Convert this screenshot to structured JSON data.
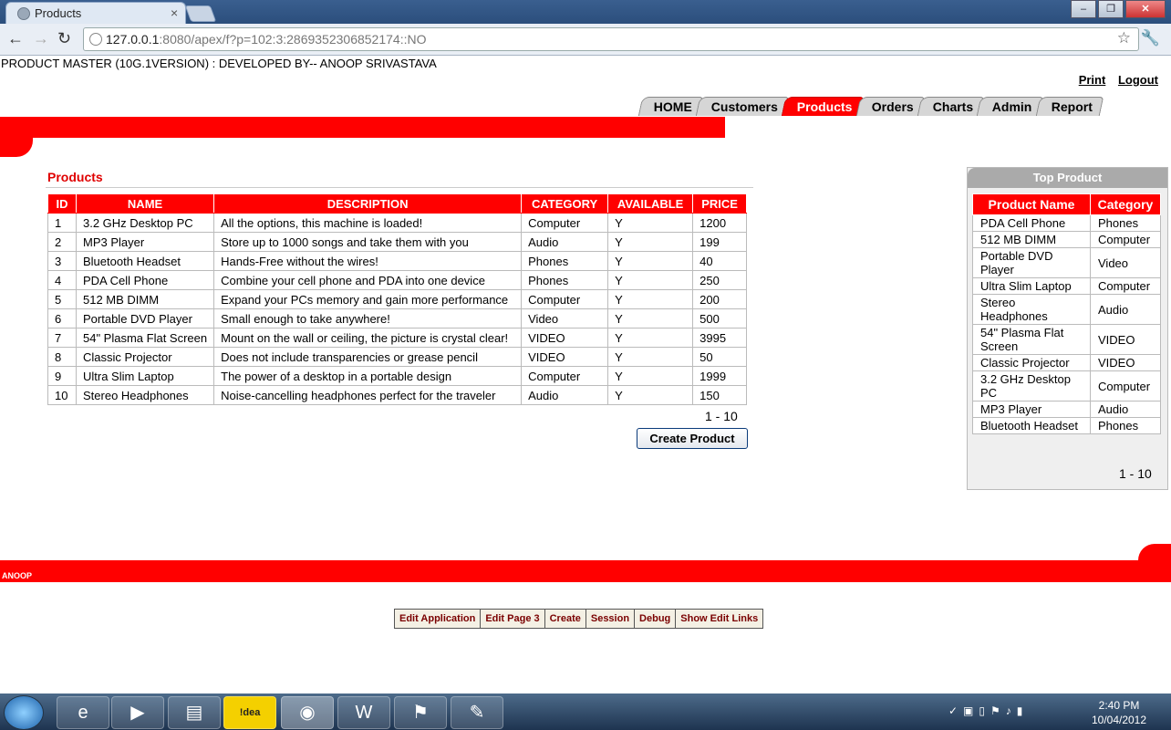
{
  "browser": {
    "tab_title": "Products",
    "url_host": "127.0.0.1",
    "url_rest": ":8080/apex/f?p=102:3:2869352306852174::NO"
  },
  "app": {
    "title": "PRODUCT MASTER (10G.1VERSION) : DEVELOPED BY-- ANOOP SRIVASTAVA",
    "links": {
      "print": "Print",
      "logout": "Logout"
    },
    "tabs": [
      {
        "label": "HOME",
        "active": false
      },
      {
        "label": "Customers",
        "active": false
      },
      {
        "label": "Products",
        "active": true
      },
      {
        "label": "Orders",
        "active": false
      },
      {
        "label": "Charts",
        "active": false
      },
      {
        "label": "Admin",
        "active": false
      },
      {
        "label": "Report",
        "active": false
      }
    ]
  },
  "products": {
    "title": "Products",
    "columns": [
      "ID",
      "NAME",
      "DESCRIPTION",
      "CATEGORY",
      "AVAILABLE",
      "PRICE"
    ],
    "rows": [
      [
        "1",
        "3.2 GHz Desktop PC",
        "All the options, this machine is loaded!",
        "Computer",
        "Y",
        "1200"
      ],
      [
        "2",
        "MP3 Player",
        "Store up to 1000 songs and take them with you",
        "Audio",
        "Y",
        "199"
      ],
      [
        "3",
        "Bluetooth Headset",
        "Hands-Free without the wires!",
        "Phones",
        "Y",
        "40"
      ],
      [
        "4",
        "PDA Cell Phone",
        "Combine your cell phone and PDA into one device",
        "Phones",
        "Y",
        "250"
      ],
      [
        "5",
        "512 MB DIMM",
        "Expand your PCs memory and gain more performance",
        "Computer",
        "Y",
        "200"
      ],
      [
        "6",
        "Portable DVD Player",
        "Small enough to take anywhere!",
        "Video",
        "Y",
        "500"
      ],
      [
        "7",
        "54\" Plasma Flat Screen",
        "Mount on the wall or ceiling, the picture is crystal clear!",
        "VIDEO",
        "Y",
        "3995"
      ],
      [
        "8",
        "Classic Projector",
        "Does not include transparencies or grease pencil",
        "VIDEO",
        "Y",
        "50"
      ],
      [
        "9",
        "Ultra Slim Laptop",
        "The power of a desktop in a portable design",
        "Computer",
        "Y",
        "1999"
      ],
      [
        "10",
        "Stereo Headphones",
        "Noise-cancelling headphones perfect for the traveler",
        "Audio",
        "Y",
        "150"
      ]
    ],
    "pagination": "1 - 10",
    "create_button": "Create Product"
  },
  "top_product": {
    "title": "Top Product",
    "columns": [
      "Product Name",
      "Category"
    ],
    "rows": [
      [
        "PDA Cell Phone",
        "Phones"
      ],
      [
        "512 MB DIMM",
        "Computer"
      ],
      [
        "Portable DVD Player",
        "Video"
      ],
      [
        "Ultra Slim Laptop",
        "Computer"
      ],
      [
        "Stereo Headphones",
        "Audio"
      ],
      [
        "54\" Plasma Flat Screen",
        "VIDEO"
      ],
      [
        "Classic Projector",
        "VIDEO"
      ],
      [
        "3.2 GHz Desktop PC",
        "Computer"
      ],
      [
        "MP3 Player",
        "Audio"
      ],
      [
        "Bluetooth Headset",
        "Phones"
      ]
    ],
    "pagination": "1 - 10"
  },
  "footer": {
    "text": "ANOOP",
    "dev_links": [
      "Edit Application",
      "Edit Page 3",
      "Create",
      "Session",
      "Debug",
      "Show Edit Links"
    ]
  },
  "taskbar": {
    "time": "2:40 PM",
    "date": "10/04/2012",
    "apps": [
      "ie-icon",
      "media-player-icon",
      "explorer-icon",
      "idea-icon",
      "chrome-icon",
      "word-icon",
      "acrobat-icon",
      "paint-icon"
    ],
    "idea_label": "!dea"
  },
  "colors": {
    "accent": "#ff0000",
    "tab_inactive": "#d6d6d6",
    "side_head": "#aaaaaa"
  }
}
